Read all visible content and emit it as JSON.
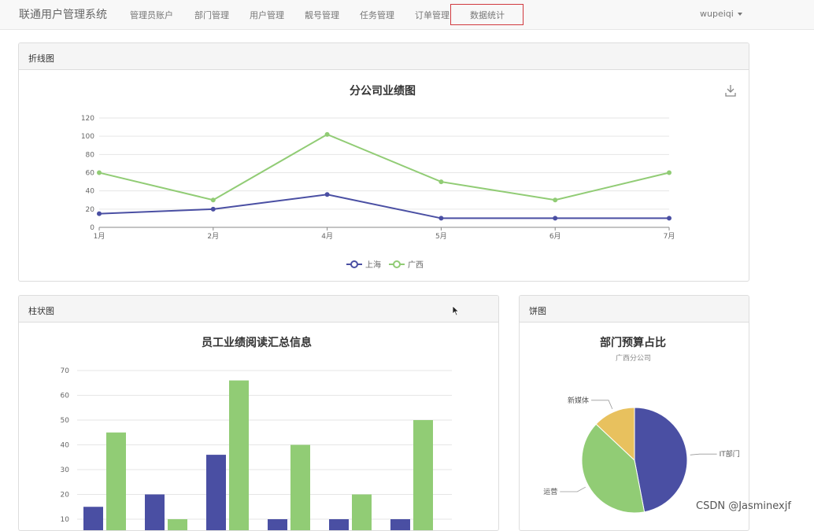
{
  "app": {
    "brand": "联通用户管理系统"
  },
  "nav": {
    "items": [
      "管理员账户",
      "部门管理",
      "用户管理",
      "靓号管理",
      "任务管理",
      "订单管理",
      "数据统计"
    ],
    "active_index": 6,
    "user": "wupeiqi"
  },
  "panels": {
    "line": {
      "heading": "折线图"
    },
    "bar": {
      "heading": "柱状图"
    },
    "pie": {
      "heading": "饼图"
    }
  },
  "watermark": "CSDN @Jasminexjf",
  "colors": {
    "series_a": "#4a4fa3",
    "series_b": "#91cc75",
    "pie_yellow": "#e8c15e",
    "highlight_border": "#d0393e"
  },
  "chart_data": [
    {
      "type": "line",
      "title": "分公司业绩图",
      "categories": [
        "1月",
        "2月",
        "4月",
        "5月",
        "6月",
        "7月"
      ],
      "series": [
        {
          "name": "上海",
          "values": [
            15,
            20,
            36,
            10,
            10,
            10
          ]
        },
        {
          "name": "广西",
          "values": [
            60,
            30,
            102,
            50,
            30,
            60
          ]
        }
      ],
      "yticks": [
        0,
        20,
        40,
        60,
        80,
        100,
        120
      ],
      "ylim": [
        0,
        120
      ],
      "legend": "bottom-center",
      "toolbox_icon": "download-icon"
    },
    {
      "type": "bar",
      "title": "员工业绩阅读汇总信息",
      "groups": 6,
      "series": [
        {
          "name": "",
          "values": [
            15,
            20,
            36,
            10,
            10,
            10
          ]
        },
        {
          "name": "",
          "values": [
            45,
            10,
            66,
            40,
            20,
            50
          ]
        }
      ],
      "yticks": [
        10,
        20,
        30,
        40,
        50,
        60,
        70
      ],
      "ylim": [
        10,
        70
      ]
    },
    {
      "type": "pie",
      "title": "部门预算占比",
      "subtitle": "广西分公司",
      "slices": [
        {
          "name": "IT部门",
          "value": 47
        },
        {
          "name": "运营",
          "value": 40
        },
        {
          "name": "新媒体",
          "value": 13
        }
      ]
    }
  ]
}
